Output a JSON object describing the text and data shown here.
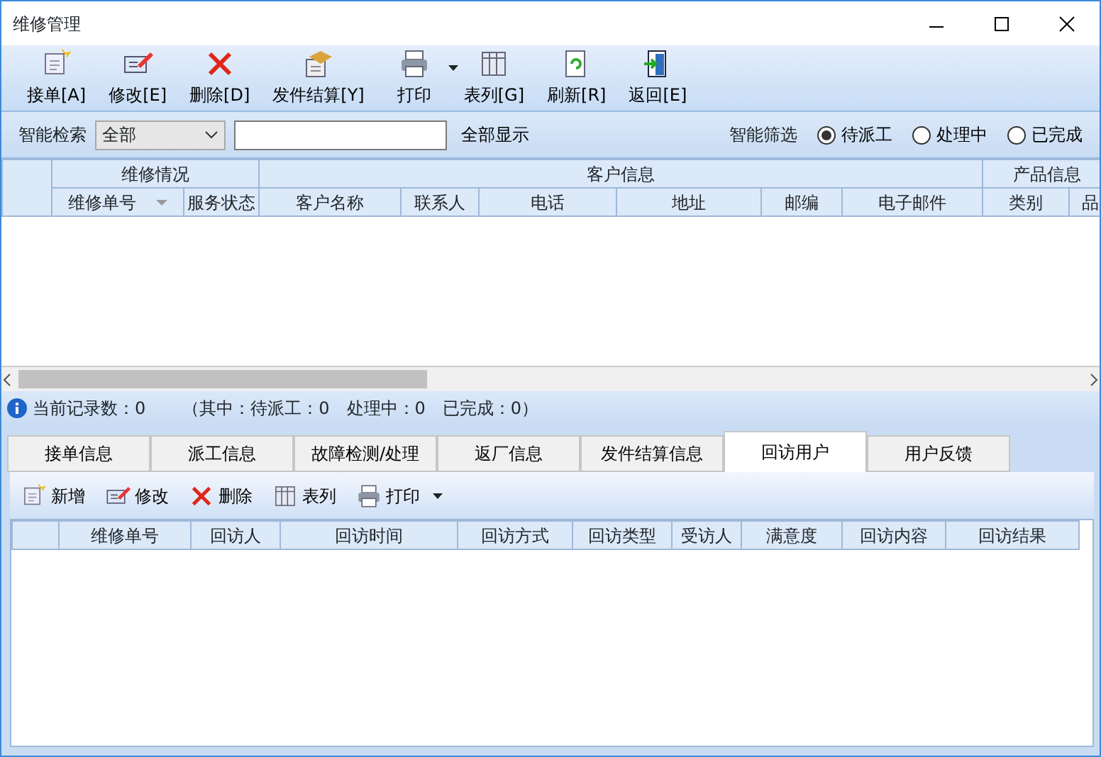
{
  "window": {
    "title": "维修管理"
  },
  "toolbar": [
    {
      "label": "接单[A]"
    },
    {
      "label": "修改[E]"
    },
    {
      "label": "删除[D]"
    },
    {
      "label": "发件结算[Y]"
    },
    {
      "label": "打印",
      "dropdown": true
    },
    {
      "label": "表列[G]"
    },
    {
      "label": "刷新[R]"
    },
    {
      "label": "返回[E]"
    }
  ],
  "search": {
    "label": "智能检索",
    "scope": "全部",
    "show_all": "全部显示"
  },
  "filter": {
    "label": "智能筛选",
    "options": [
      {
        "label": "待派工",
        "selected": true
      },
      {
        "label": "处理中",
        "selected": false
      },
      {
        "label": "已完成",
        "selected": false
      }
    ]
  },
  "table": {
    "groups": [
      {
        "label": "维修情况"
      },
      {
        "label": "客户信息"
      },
      {
        "label": "产品信息"
      }
    ],
    "columns": [
      "维修单号",
      "服务状态",
      "客户名称",
      "联系人",
      "电话",
      "地址",
      "邮编",
      "电子邮件",
      "类别",
      "品"
    ]
  },
  "status_bar": {
    "count": "当前记录数：0",
    "detail": "（其中：待派工：0　处理中：0　已完成：0）"
  },
  "tabs": [
    {
      "label": "接单信息",
      "selected": false
    },
    {
      "label": "派工信息",
      "selected": false
    },
    {
      "label": "故障检测/处理",
      "selected": false
    },
    {
      "label": "返厂信息",
      "selected": false
    },
    {
      "label": "发件结算信息",
      "selected": false
    },
    {
      "label": "回访用户",
      "selected": true
    },
    {
      "label": "用户反馈",
      "selected": false
    }
  ],
  "sub_toolbar": [
    {
      "label": "新增"
    },
    {
      "label": "修改"
    },
    {
      "label": "删除"
    },
    {
      "label": "表列"
    },
    {
      "label": "打印",
      "dropdown": true
    }
  ],
  "sub_table": {
    "columns": [
      "维修单号",
      "回访人",
      "回访时间",
      "回访方式",
      "回访类型",
      "受访人",
      "满意度",
      "回访内容",
      "回访结果"
    ]
  }
}
